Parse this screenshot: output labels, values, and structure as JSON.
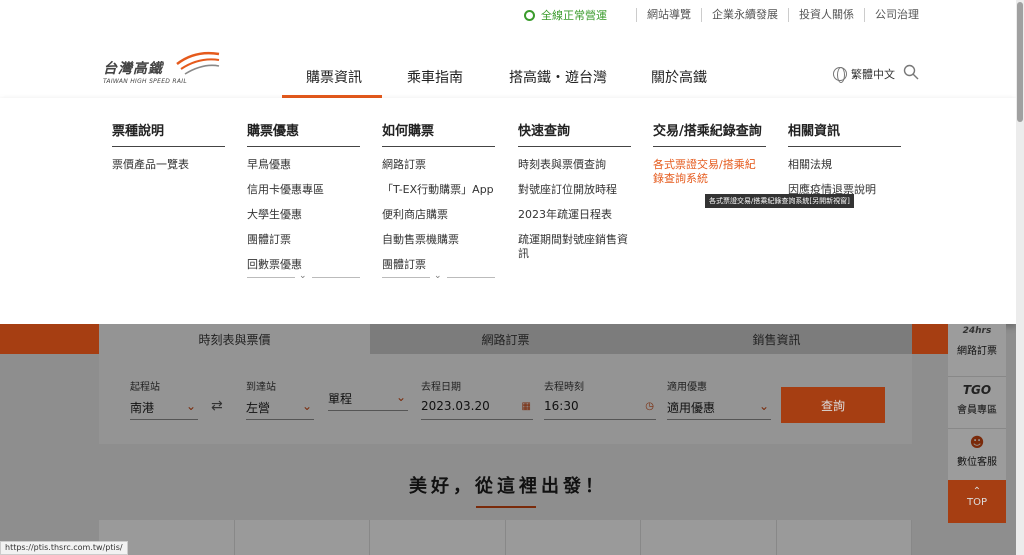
{
  "topbar": {
    "status": "全線正常營運",
    "links": [
      "網站導覽",
      "企業永續發展",
      "投資人關係",
      "公司治理"
    ]
  },
  "header": {
    "logo_cn": "台灣高鐵",
    "logo_en": "TAIWAN HIGH SPEED RAIL",
    "nav": [
      "購票資訊",
      "乘車指南",
      "搭高鐵・遊台灣",
      "關於高鐵"
    ],
    "language": "繁體中文"
  },
  "mega_menu": {
    "columns": [
      {
        "title": "票種說明",
        "items": [
          "票價產品一覽表"
        ]
      },
      {
        "title": "購票優惠",
        "items": [
          "早鳥優惠",
          "信用卡優惠專區",
          "大學生優惠",
          "團體訂票",
          "回數票優惠"
        ]
      },
      {
        "title": "如何購票",
        "items": [
          "網路訂票",
          "「T-EX行動購票」App",
          "便利商店購票",
          "自動售票機購票",
          "團體訂票"
        ]
      },
      {
        "title": "快速查詢",
        "items": [
          "時刻表與票價查詢",
          "對號座訂位開放時程",
          "2023年疏運日程表",
          "疏運期間對號座銷售資訊"
        ]
      },
      {
        "title": "交易/搭乘紀錄查詢",
        "items": [
          "各式票證交易/搭乘紀錄查詢系統"
        ]
      },
      {
        "title": "相關資訊",
        "items": [
          "相關法規",
          "因應疫情退票說明"
        ]
      }
    ],
    "tooltip": "各式票證交易/搭乘紀錄查詢系統[另開新視窗]"
  },
  "booking": {
    "tabs": [
      "時刻表與票價",
      "網路訂票",
      "銷售資訊"
    ],
    "origin_label": "起程站",
    "origin": "南港",
    "dest_label": "到達站",
    "dest": "左營",
    "trip_type": "單程",
    "date_label": "去程日期",
    "date": "2023.03.20",
    "time_label": "去程時刻",
    "time": "16:30",
    "discount_label": "適用優惠",
    "discount": "適用優惠",
    "search": "查詢"
  },
  "slogan": "美好，從這裡出發！",
  "sidebar": {
    "booking_brand": "24hrs",
    "booking": "網路訂票",
    "member_brand": "TGO",
    "member": "會員專區",
    "service": "數位客服",
    "top": "TOP"
  },
  "status_url": "https://ptis.thsrc.com.tw/ptis/"
}
